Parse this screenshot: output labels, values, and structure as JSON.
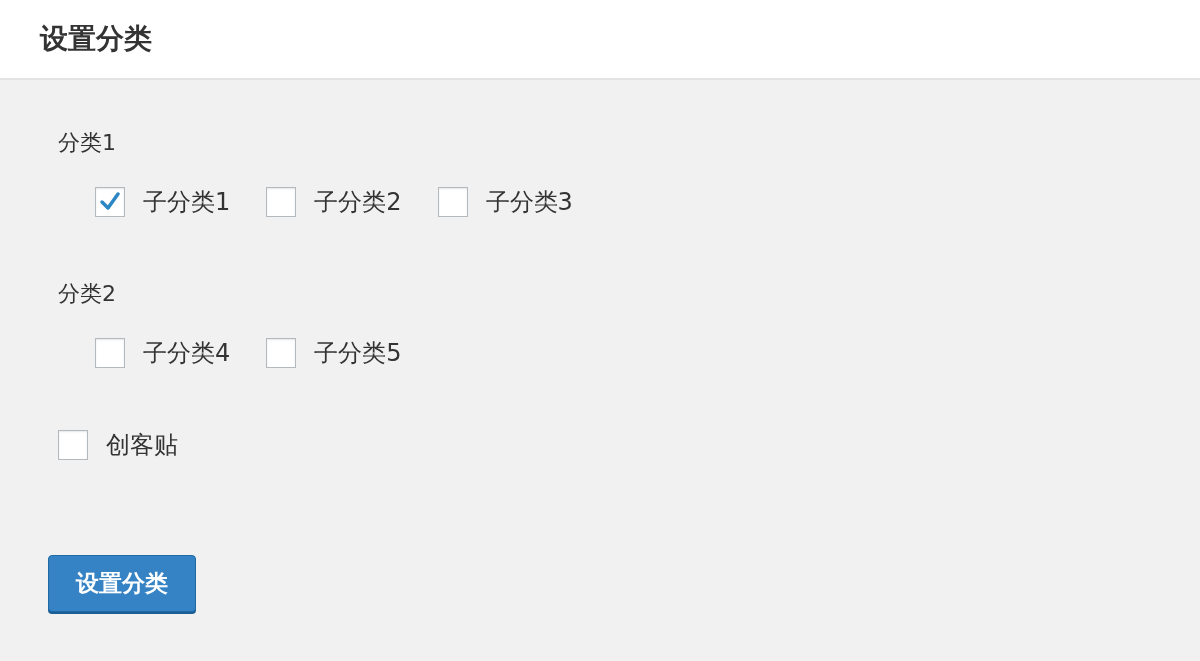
{
  "header": {
    "title": "设置分类"
  },
  "groups": [
    {
      "label": "分类1",
      "items": [
        {
          "label": "子分类1",
          "checked": true
        },
        {
          "label": "子分类2",
          "checked": false
        },
        {
          "label": "子分类3",
          "checked": false
        }
      ]
    },
    {
      "label": "分类2",
      "items": [
        {
          "label": "子分类4",
          "checked": false
        },
        {
          "label": "子分类5",
          "checked": false
        }
      ]
    }
  ],
  "standalone": [
    {
      "label": "创客贴",
      "checked": false
    }
  ],
  "button": {
    "label": "设置分类"
  }
}
